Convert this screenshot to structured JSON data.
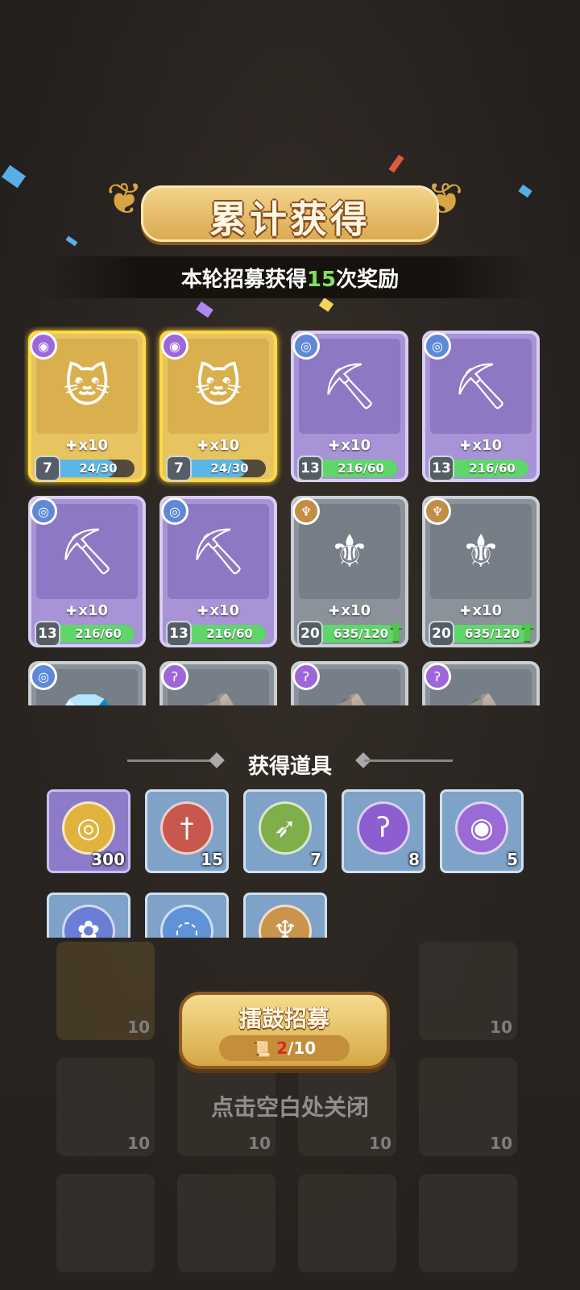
{
  "header": {
    "title": "累计获得",
    "subtitle_prefix": "本轮招募获得",
    "subtitle_count": "15",
    "subtitle_suffix": "次奖励"
  },
  "cards": [
    {
      "rarity": "gold",
      "badge": "eye-icon",
      "hero": "fisher-cat",
      "qty": "x10",
      "level": "7",
      "progress": "24/30",
      "fill": 0.8,
      "bar_color": "#5ab6e6",
      "upgrade": false
    },
    {
      "rarity": "gold",
      "badge": "eye-icon",
      "hero": "fisher-cat",
      "qty": "x10",
      "level": "7",
      "progress": "24/30",
      "fill": 0.8,
      "bar_color": "#5ab6e6",
      "upgrade": false
    },
    {
      "rarity": "purple",
      "badge": "swirl-icon",
      "hero": "miner-mole",
      "qty": "x10",
      "level": "13",
      "progress": "216/60",
      "fill": 1.0,
      "bar_color": "#5fd66a",
      "upgrade": false
    },
    {
      "rarity": "purple",
      "badge": "swirl-icon",
      "hero": "miner-mole",
      "qty": "x10",
      "level": "13",
      "progress": "216/60",
      "fill": 1.0,
      "bar_color": "#5fd66a",
      "upgrade": false
    },
    {
      "rarity": "purple",
      "badge": "swirl-icon",
      "hero": "miner-mole",
      "qty": "x10",
      "level": "13",
      "progress": "216/60",
      "fill": 1.0,
      "bar_color": "#5fd66a",
      "upgrade": false
    },
    {
      "rarity": "purple",
      "badge": "swirl-icon",
      "hero": "miner-mole",
      "qty": "x10",
      "level": "13",
      "progress": "216/60",
      "fill": 1.0,
      "bar_color": "#5fd66a",
      "upgrade": false
    },
    {
      "rarity": "gray",
      "badge": "wing-icon",
      "hero": "priest",
      "qty": "x10",
      "level": "20",
      "progress": "635/120",
      "fill": 1.0,
      "bar_color": "#5fd66a",
      "upgrade": true
    },
    {
      "rarity": "gray",
      "badge": "wing-icon",
      "hero": "priest",
      "qty": "x10",
      "level": "20",
      "progress": "635/120",
      "fill": 1.0,
      "bar_color": "#5fd66a",
      "upgrade": true
    },
    {
      "rarity": "gray",
      "badge": "swirl-icon",
      "hero": "crystal",
      "qty": "",
      "level": "",
      "progress": "",
      "fill": 0,
      "bar_color": "#5fd66a",
      "upgrade": false
    },
    {
      "rarity": "gray",
      "badge": "hook-icon",
      "hero": "rock",
      "qty": "",
      "level": "",
      "progress": "",
      "fill": 0,
      "bar_color": "#5fd66a",
      "upgrade": false
    },
    {
      "rarity": "gray",
      "badge": "hook-icon",
      "hero": "rock",
      "qty": "",
      "level": "",
      "progress": "",
      "fill": 0,
      "bar_color": "#5fd66a",
      "upgrade": false
    },
    {
      "rarity": "gray",
      "badge": "hook-icon",
      "hero": "rock",
      "qty": "",
      "level": "",
      "progress": "",
      "fill": 0,
      "bar_color": "#5fd66a",
      "upgrade": false
    }
  ],
  "items_section": {
    "title": "获得道具",
    "items": [
      {
        "icon": "gold-coin-icon",
        "count": "300",
        "bg": "purple",
        "orb": "#e1b23e",
        "glyph": "◎"
      },
      {
        "icon": "sword-emblem-icon",
        "count": "15",
        "bg": "blue",
        "orb": "#c8574d",
        "glyph": "†"
      },
      {
        "icon": "bow-emblem-icon",
        "count": "7",
        "bg": "blue",
        "orb": "#7fae4a",
        "glyph": "➶"
      },
      {
        "icon": "hook-emblem-icon",
        "count": "8",
        "bg": "blue",
        "orb": "#8c5ed0",
        "glyph": "ʔ"
      },
      {
        "icon": "eye-emblem-icon",
        "count": "5",
        "bg": "blue",
        "orb": "#9a6bd6",
        "glyph": "◉"
      },
      {
        "icon": "paw-emblem-icon",
        "count": "",
        "bg": "blue",
        "orb": "#6a7ed6",
        "glyph": "✿"
      },
      {
        "icon": "swirl-emblem-icon",
        "count": "",
        "bg": "blue",
        "orb": "#5f93d8",
        "glyph": "◌"
      },
      {
        "icon": "wing-emblem-icon",
        "count": "",
        "bg": "blue",
        "orb": "#c9944b",
        "glyph": "♆"
      }
    ]
  },
  "recruit_button": {
    "label": "擂鼓招募",
    "count_current": "2",
    "count_total": "/10"
  },
  "close_hint": "点击空白处关闭",
  "background": {
    "behind_counts": [
      "10",
      "10",
      "10",
      "10",
      "10",
      "10"
    ]
  }
}
